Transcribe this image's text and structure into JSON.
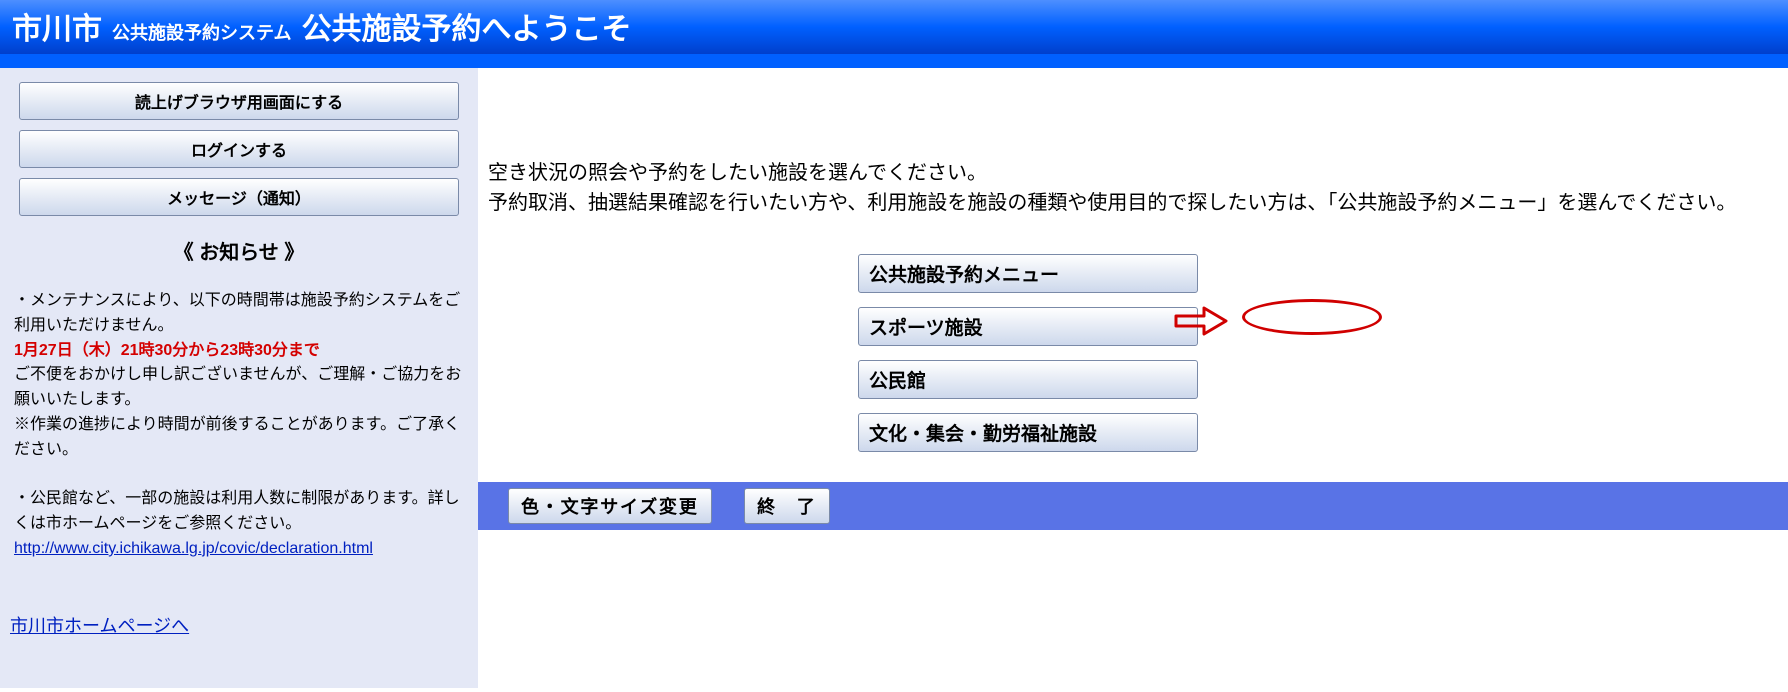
{
  "header": {
    "city": "市川市",
    "system": "公共施設予約システム",
    "welcome": "公共施設予約へようこそ"
  },
  "sidebar": {
    "buttons": {
      "reader": "読上げブラウザ用画面にする",
      "login": "ログインする",
      "messages": "メッセージ（通知）"
    },
    "notice_head": "《 お知らせ 》",
    "notice_line1": "・メンテナンスにより、以下の時間帯は施設予約システムをご利用いただけません。",
    "notice_red": "1月27日（木）21時30分から23時30分まで",
    "notice_line2": "ご不便をおかけし申し訳ございませんが、ご理解・ご協力をお願いいたします。",
    "notice_line3": "※作業の進捗により時間が前後することがあります。ご了承ください。",
    "notice_line4": "・公民館など、一部の施設は利用人数に制限があります。詳しくは市ホームページをご参照ください。",
    "notice_url": "http://www.city.ichikawa.lg.jp/covic/declaration.html",
    "home_link": "市川市ホームページへ"
  },
  "main": {
    "instruction1": "空き状況の照会や予約をしたい施設を選んでください。",
    "instruction2": "予約取消、抽選結果確認を行いたい方や、利用施設を施設の種類や使用目的で探したい方は、「公共施設予約メニュー」を選んでください。",
    "menu": {
      "reservation": "公共施設予約メニュー",
      "sports": "スポーツ施設",
      "community": "公民館",
      "culture": "文化・集会・勤労福祉施設"
    }
  },
  "footer": {
    "color_size": "色・文字サイズ変更",
    "exit": "終　了"
  }
}
